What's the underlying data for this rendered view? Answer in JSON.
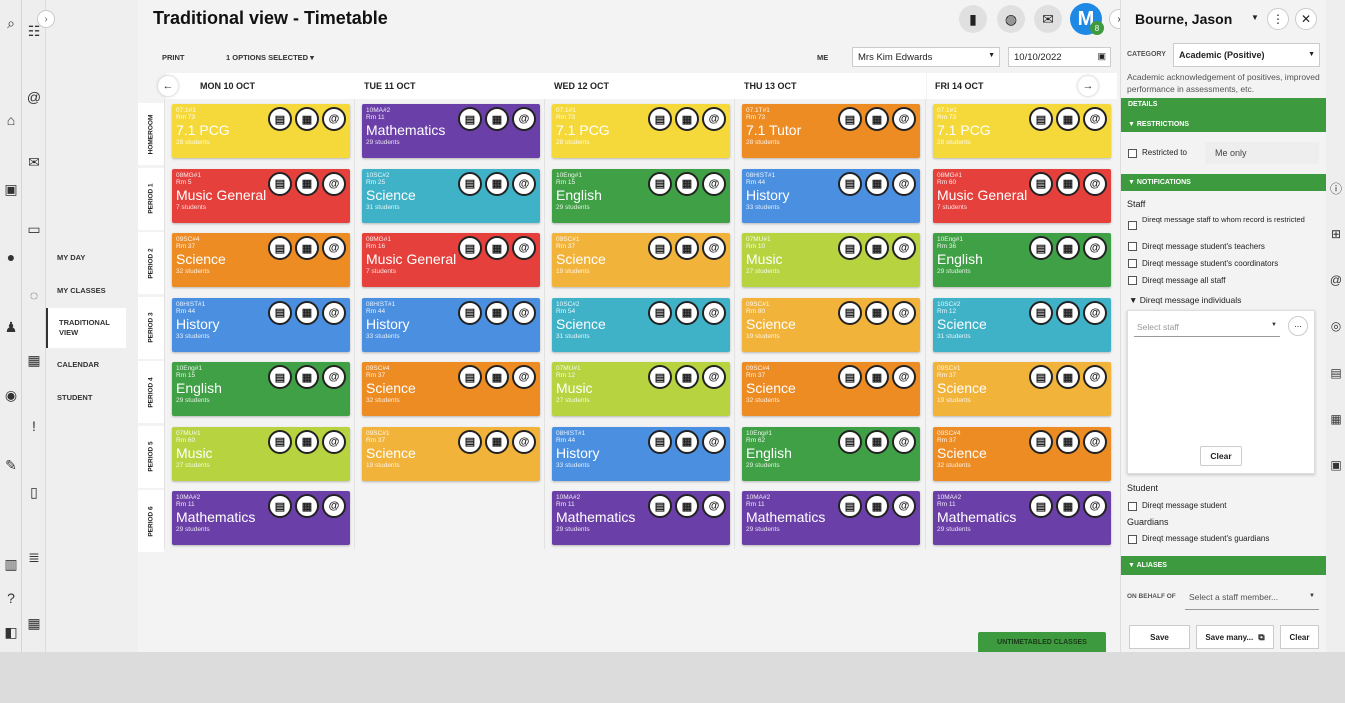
{
  "title": "Traditional view - Timetable",
  "nav": {
    "items": [
      {
        "label": "MY DAY"
      },
      {
        "label": "MY CLASSES"
      },
      {
        "label": "TRADITIONAL VIEW"
      },
      {
        "label": "CALENDAR"
      },
      {
        "label": "STUDENT"
      }
    ]
  },
  "header": {
    "avatar_letter": "M",
    "avatar_badge": "8"
  },
  "toolbar": {
    "print_label": "PRINT",
    "options_label": "1 OPTIONS SELECTED ▾",
    "me_label": "ME",
    "staff_value": "Mrs Kim Edwards",
    "date_value": "10/10/2022"
  },
  "days": [
    "MON 10 OCT",
    "TUE 11 OCT",
    "WED 12 OCT",
    "THU 13 OCT",
    "FRI 14 OCT"
  ],
  "periods": [
    "HOMEROOM",
    "PERIOD 1",
    "PERIOD 2",
    "PERIOD 3",
    "PERIOD 4",
    "PERIOD 5",
    "PERIOD 6"
  ],
  "classes": [
    [
      {
        "code": "07.1#1",
        "room": "Rm 73",
        "subject": "7.1 PCG",
        "students": "28 students",
        "color": "#f5d93a"
      },
      {
        "code": "10MA#2",
        "room": "Rm 11",
        "subject": "Mathematics",
        "students": "29 students",
        "color": "#6b3fa8"
      },
      {
        "code": "07.1#1",
        "room": "Rm 73",
        "subject": "7.1 PCG",
        "students": "28 students",
        "color": "#f5d93a"
      },
      {
        "code": "07.1T#1",
        "room": "Rm 73",
        "subject": "7.1 Tutor",
        "students": "28 students",
        "color": "#ee8c24"
      },
      {
        "code": "07.1#1",
        "room": "Rm 73",
        "subject": "7.1 PCG",
        "students": "28 students",
        "color": "#f5d93a"
      }
    ],
    [
      {
        "code": "08MG#1",
        "room": "Rm 5",
        "subject": "Music General",
        "students": "7 students",
        "color": "#e5403b"
      },
      {
        "code": "10SC#2",
        "room": "Rm 25",
        "subject": "Science",
        "students": "31 students",
        "color": "#3fb2c8"
      },
      {
        "code": "10Eng#1",
        "room": "Rm 15",
        "subject": "English",
        "students": "29 students",
        "color": "#3fa045"
      },
      {
        "code": "08HIST#1",
        "room": "Rm 44",
        "subject": "History",
        "students": "33 students",
        "color": "#4a8fe0"
      },
      {
        "code": "08MG#1",
        "room": "Rm 60",
        "subject": "Music General",
        "students": "7 students",
        "color": "#e5403b"
      }
    ],
    [
      {
        "code": "09SC#4",
        "room": "Rm 37",
        "subject": "Science",
        "students": "32 students",
        "color": "#ee8c24"
      },
      {
        "code": "08MG#1",
        "room": "Rm 16",
        "subject": "Music General",
        "students": "7 students",
        "color": "#e5403b"
      },
      {
        "code": "09SC#1",
        "room": "Rm 37",
        "subject": "Science",
        "students": "19 students",
        "color": "#f2b33a"
      },
      {
        "code": "07MU#1",
        "room": "Rm 10",
        "subject": "Music",
        "students": "27 students",
        "color": "#b7d440"
      },
      {
        "code": "10Eng#1",
        "room": "Rm 36",
        "subject": "English",
        "students": "29 students",
        "color": "#3fa045"
      }
    ],
    [
      {
        "code": "08HIST#1",
        "room": "Rm 44",
        "subject": "History",
        "students": "33 students",
        "color": "#4a8fe0"
      },
      {
        "code": "08HIST#1",
        "room": "Rm 44",
        "subject": "History",
        "students": "33 students",
        "color": "#4a8fe0"
      },
      {
        "code": "10SC#2",
        "room": "Rm 54",
        "subject": "Science",
        "students": "31 students",
        "color": "#3fb2c8"
      },
      {
        "code": "09SC#1",
        "room": "Rm 80",
        "subject": "Science",
        "students": "19 students",
        "color": "#f2b33a"
      },
      {
        "code": "10SC#2",
        "room": "Rm 12",
        "subject": "Science",
        "students": "31 students",
        "color": "#3fb2c8"
      }
    ],
    [
      {
        "code": "10Eng#1",
        "room": "Rm 15",
        "subject": "English",
        "students": "29 students",
        "color": "#3fa045"
      },
      {
        "code": "09SC#4",
        "room": "Rm 37",
        "subject": "Science",
        "students": "32 students",
        "color": "#ee8c24"
      },
      {
        "code": "07MU#1",
        "room": "Rm 12",
        "subject": "Music",
        "students": "27 students",
        "color": "#b7d440"
      },
      {
        "code": "09SC#4",
        "room": "Rm 37",
        "subject": "Science",
        "students": "32 students",
        "color": "#ee8c24"
      },
      {
        "code": "09SC#1",
        "room": "Rm 37",
        "subject": "Science",
        "students": "19 students",
        "color": "#f2b33a"
      }
    ],
    [
      {
        "code": "07MU#1",
        "room": "Rm 60",
        "subject": "Music",
        "students": "27 students",
        "color": "#b7d440"
      },
      {
        "code": "09SC#1",
        "room": "Rm 37",
        "subject": "Science",
        "students": "19 students",
        "color": "#f2b33a"
      },
      {
        "code": "08HIST#1",
        "room": "Rm 44",
        "subject": "History",
        "students": "33 students",
        "color": "#4a8fe0"
      },
      {
        "code": "10Eng#1",
        "room": "Rm 62",
        "subject": "English",
        "students": "29 students",
        "color": "#3fa045"
      },
      {
        "code": "09SC#4",
        "room": "Rm 37",
        "subject": "Science",
        "students": "32 students",
        "color": "#ee8c24"
      }
    ],
    [
      {
        "code": "10MA#2",
        "room": "Rm 11",
        "subject": "Mathematics",
        "students": "29 students",
        "color": "#6b3fa8"
      },
      null,
      {
        "code": "10MA#2",
        "room": "Rm 11",
        "subject": "Mathematics",
        "students": "29 students",
        "color": "#6b3fa8"
      },
      {
        "code": "10MA#2",
        "room": "Rm 11",
        "subject": "Mathematics",
        "students": "29 students",
        "color": "#6b3fa8"
      },
      {
        "code": "10MA#2",
        "room": "Rm 11",
        "subject": "Mathematics",
        "students": "29 students",
        "color": "#6b3fa8"
      }
    ]
  ],
  "untimetabled_label": "UNTIMETABLED CLASSES",
  "panel": {
    "student_name": "Bourne, Jason",
    "category_label": "CATEGORY",
    "category_value": "Academic (Positive)",
    "category_desc": "Academic acknowledgement of positives, improved performance in assessments, etc.",
    "details_label": "DETAILS",
    "restrictions_label": "▼ RESTRICTIONS",
    "restricted_to_label": "Restricted to",
    "restricted_to_value": "Me only",
    "notifications_label": "▼ NOTIFICATIONS",
    "staff_heading": "Staff",
    "staff_options": [
      "Direqt message staff to whom record is restricted",
      "Direqt message student's teachers",
      "Direqt message student's coordinators",
      "Direqt message all staff"
    ],
    "individuals_label": "▼ Direqt message individuals",
    "select_staff_placeholder": "Select staff",
    "more_label": "...",
    "clear_label": "Clear",
    "student_heading": "Student",
    "student_option": "Direqt message student",
    "guardians_heading": "Guardians",
    "guardians_option": "Direqt message student's guardians",
    "aliases_label": "▼ ALIASES",
    "on_behalf_label": "ON BEHALF OF",
    "on_behalf_placeholder": "Select a staff member...",
    "save_label": "Save",
    "save_many_label": "Save many...",
    "clear_bottom_label": "Clear"
  },
  "colors": {
    "accent_green": "#3e9a3e",
    "avatar_blue": "#1e88e5"
  }
}
